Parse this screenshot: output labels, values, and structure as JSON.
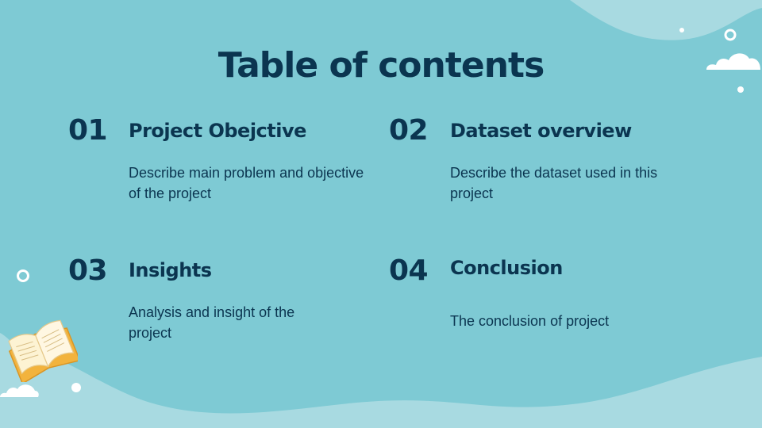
{
  "slide": {
    "title": "Table of contents",
    "items": [
      {
        "number": "01",
        "heading": "Project Obejctive",
        "description": "Describe main problem and objective of the project"
      },
      {
        "number": "02",
        "heading": "Dataset overview",
        "description": "Describe the dataset used in this project"
      },
      {
        "number": "03",
        "heading": "Insights",
        "description": "Analysis and insight of the project"
      },
      {
        "number": "04",
        "heading": "Conclusion",
        "description": "The conclusion of project"
      }
    ]
  },
  "colors": {
    "background": "#7ecad4",
    "wave_light": "#a8dae1",
    "text": "#0b3550",
    "book_cover": "#f2b33d",
    "book_pages": "#fdf3d3"
  },
  "icons": [
    "cloud-icon",
    "ring-icon",
    "dot-icon",
    "open-book-icon"
  ]
}
